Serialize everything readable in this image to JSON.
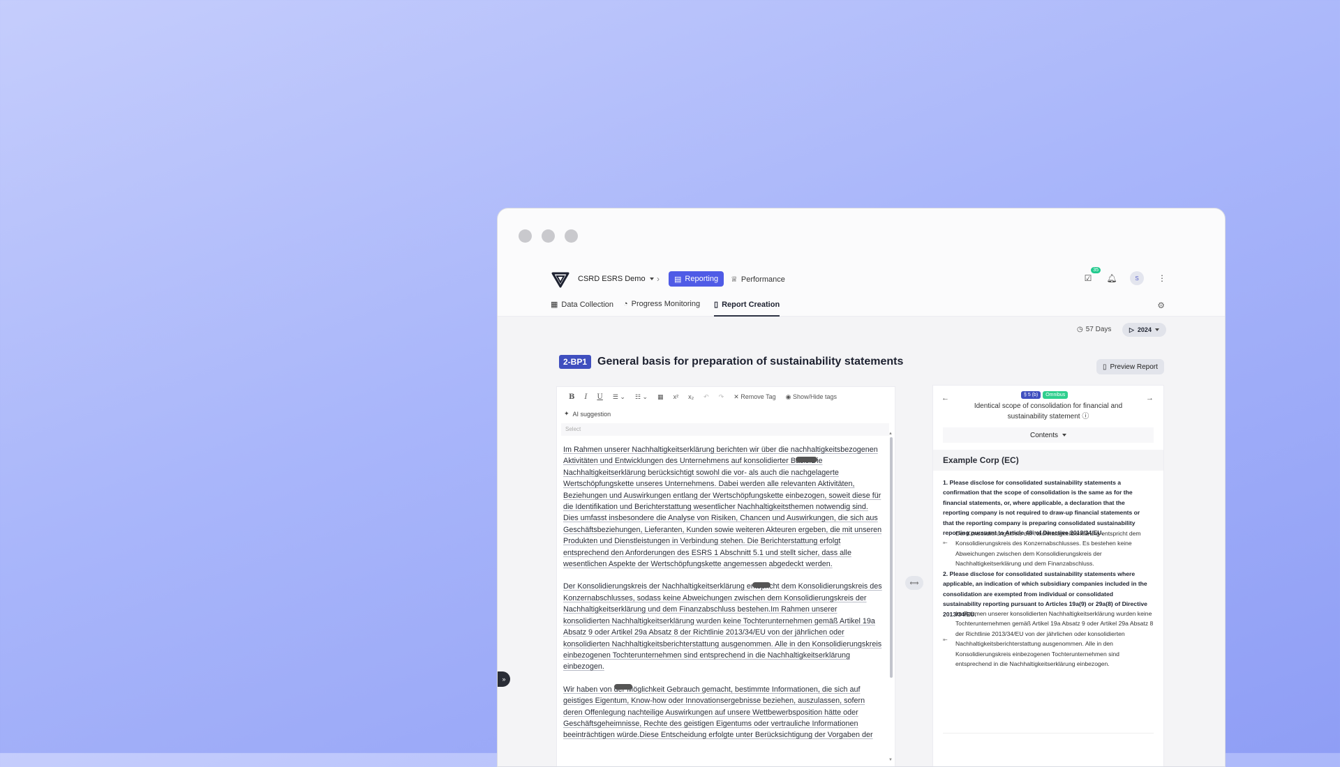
{
  "window": {
    "controls": [
      "close",
      "minimize",
      "maximize"
    ]
  },
  "topbar": {
    "org_name": "CSRD ESRS Demo",
    "reporting_label": "Reporting",
    "performance_label": "Performance",
    "notification_count": "35",
    "avatar_initial": "S"
  },
  "subnav": {
    "tabs": [
      {
        "label": "Data Collection",
        "active": false
      },
      {
        "label": "Progress Monitoring",
        "active": false
      },
      {
        "label": "Report Creation",
        "active": true
      }
    ]
  },
  "status": {
    "days_remaining": "57 Days",
    "year": "2024"
  },
  "section": {
    "code": "2-BP1",
    "title": "General basis for preparation of sustainability statements",
    "preview_label": "Preview Report"
  },
  "editor": {
    "toolbar": {
      "bold": "B",
      "italic": "I",
      "underline": "U",
      "superscript": "x²",
      "subscript": "x₂",
      "remove_tag": "Remove Tag",
      "show_hide_tags": "Show/Hide tags"
    },
    "ai_suggestion": "AI suggestion",
    "select_placeholder": "Select",
    "paragraphs": [
      "Im Rahmen unserer Nachhaltigkeitserklärung berichten wir über die nachhaltigkeitsbezogenen Aktivitäten und Entwicklungen des Unternehmens auf konsolidierter Basis.Die Nachhaltigkeitserklärung berücksichtigt sowohl die vor- als auch die nachgelagerte Wertschöpfungskette unseres Unternehmens. Dabei werden alle relevanten Aktivitäten, Beziehungen und Auswirkungen entlang der Wertschöpfungskette einbezogen, soweit diese für die Identifikation und Berichterstattung wesentlicher Nachhaltigkeitsthemen notwendig sind. Dies umfasst insbesondere die Analyse von Risiken, Chancen und Auswirkungen, die sich aus Geschäftsbeziehungen, Lieferanten, Kunden sowie weiteren Akteuren ergeben, die mit unseren Produkten und Dienstleistungen in Verbindung stehen. Die Berichterstattung erfolgt entsprechend den Anforderungen des ESRS 1 Abschnitt 5.1 und stellt sicher, dass alle wesentlichen Aspekte der Wertschöpfungskette angemessen abgedeckt werden.",
      "Der Konsolidierungskreis der Nachhaltigkeitserklärung entspricht dem Konsolidierungskreis des Konzernabschlusses, sodass keine Abweichungen zwischen dem Konsolidierungskreis der Nachhaltigkeitserklärung und dem Finanzabschluss bestehen.Im Rahmen unserer konsolidierten Nachhaltigkeitserklärung wurden keine Tochterunternehmen gemäß Artikel 19a Absatz 9 oder Artikel 29a Absatz 8 der Richtlinie 2013/34/EU von der jährlichen oder konsolidierten Nachhaltigkeitsberichterstattung ausgenommen. Alle in den Konsolidierungskreis einbezogenen Tochterunternehmen sind entsprechend in die Nachhaltigkeitserklärung einbezogen.",
      "Wir haben von der Möglichkeit Gebrauch gemacht, bestimmte Informationen, die sich auf geistiges Eigentum, Know-how oder Innovationsergebnisse beziehen, auszulassen, sofern deren Offenlegung nachteilige Auswirkungen auf unsere Wettbewerbsposition hätte oder Geschäftsgeheimnisse, Rechte des geistigen Eigentums oder vertrauliche Informationen beeinträchtigen würde.Diese Entscheidung erfolgte unter Berücksichtigung der Vorgaben der"
    ]
  },
  "right_panel": {
    "chips": [
      "§ 5 (b)",
      "Omnibus"
    ],
    "subtitle": "Identical scope of consolidation for financial and sustainability statement",
    "contents_label": "Contents",
    "company": "Example Corp (EC)",
    "q1": "1. Please disclose for consolidated sustainability statements a confirmation that the scope of consolidation is the same as for the financial statements, or, where applicable, a declaration that the reporting company is not required to draw-up financial statements or that the reporting company is preparing consolidated sustainability reporting pursuant to Article 48i of Directive 2013/34/EU.",
    "a1": "Der Konsolidierungskreis der Nachhaltigkeitserklärung entspricht dem Konsolidierungskreis des Konzernabschlusses. Es bestehen keine Abweichungen zwischen dem Konsolidierungskreis der Nachhaltigkeitserklärung und dem Finanzabschluss.",
    "q2": "2. Please disclose for consolidated sustainability statements where applicable, an indication of which subsidiary companies included in the consolidation are exempted from individual or consolidated sustainability reporting pursuant to Articles 19a(9) or 29a(8) of Directive 2013/34/EU.",
    "a2": "Im Rahmen unserer konsolidierten Nachhaltigkeitserklärung wurden keine Tochterunternehmen gemäß Artikel 19a Absatz 9 oder Artikel 29a Absatz 8 der Richtlinie 2013/34/EU von der jährlichen oder konsolidierten Nachhaltigkeitsberichterstattung ausgenommen. Alle in den Konsolidierungskreis einbezogenen Tochterunternehmen sind entsprechend in die Nachhaltigkeitserklärung einbezogen."
  }
}
